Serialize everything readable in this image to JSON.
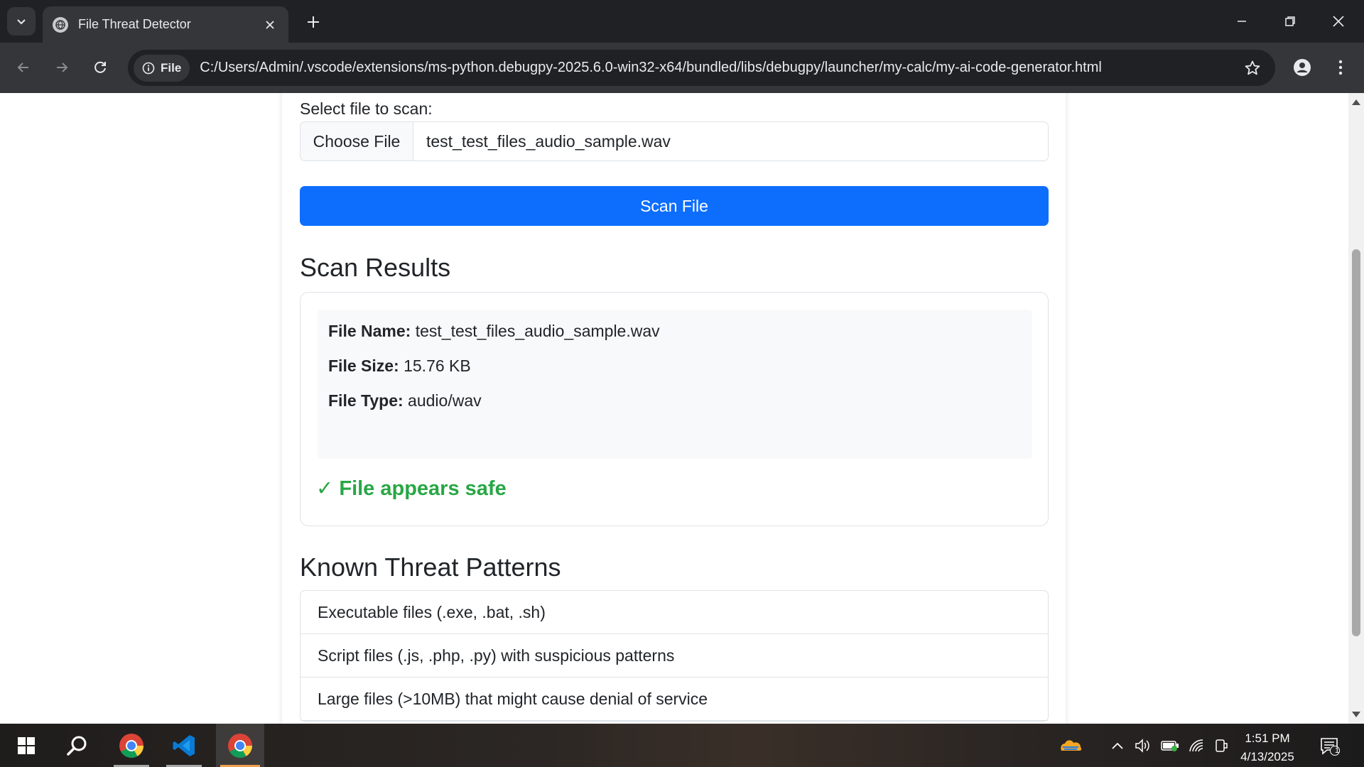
{
  "browser": {
    "tab_title": "File Threat Detector",
    "site_chip_label": "File",
    "url": "C:/Users/Admin/.vscode/extensions/ms-python.debugpy-2025.6.0-win32-x64/bundled/libs/debugpy/launcher/my-calc/my-ai-code-generator.html"
  },
  "form": {
    "file_label": "Select file to scan:",
    "choose_button": "Choose File",
    "selected_file": "test_test_files_audio_sample.wav",
    "scan_button": "Scan File"
  },
  "results": {
    "heading": "Scan Results",
    "file_name_label": "File Name:",
    "file_name": "test_test_files_audio_sample.wav",
    "file_size_label": "File Size:",
    "file_size": "15.76 KB",
    "file_type_label": "File Type:",
    "file_type": "audio/wav",
    "status": "✓ File appears safe",
    "status_color": "#28a745"
  },
  "threats": {
    "heading": "Known Threat Patterns",
    "items": [
      "Executable files (.exe, .bat, .sh)",
      "Script files (.js, .php, .py) with suspicious patterns",
      "Large files (>10MB) that might cause denial of service"
    ]
  },
  "taskbar": {
    "time": "1:51 PM",
    "date": "4/13/2025",
    "notification_count": "1"
  },
  "colors": {
    "primary": "#0d6efd",
    "chrome_dark": "#202124",
    "chrome_toolbar": "#35363a"
  }
}
